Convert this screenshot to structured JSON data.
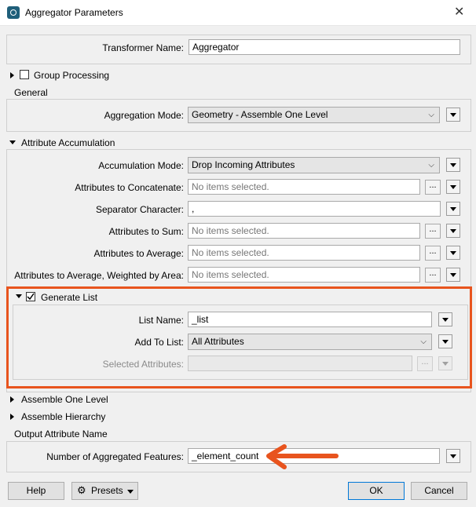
{
  "window": {
    "title": "Aggregator Parameters",
    "close": "✕"
  },
  "transformer": {
    "label": "Transformer Name:",
    "value": "Aggregator"
  },
  "group_processing": {
    "label": "Group Processing"
  },
  "general": {
    "title": "General",
    "aggregation_mode": {
      "label": "Aggregation Mode:",
      "value": "Geometry - Assemble One Level"
    }
  },
  "attribute_accumulation": {
    "title": "Attribute Accumulation",
    "accumulation_mode": {
      "label": "Accumulation Mode:",
      "value": "Drop Incoming Attributes"
    },
    "concatenate": {
      "label": "Attributes to Concatenate:",
      "placeholder": "No items selected."
    },
    "separator": {
      "label": "Separator Character:",
      "value": ","
    },
    "sum": {
      "label": "Attributes to Sum:",
      "placeholder": "No items selected."
    },
    "average": {
      "label": "Attributes to Average:",
      "placeholder": "No items selected."
    },
    "weighted": {
      "label": "Attributes to Average, Weighted by Area:",
      "placeholder": "No items selected."
    }
  },
  "generate_list": {
    "title": "Generate List",
    "checked": true,
    "list_name": {
      "label": "List Name:",
      "value": "_list"
    },
    "add_to_list": {
      "label": "Add To List:",
      "value": "All Attributes"
    },
    "selected_attributes": {
      "label": "Selected Attributes:",
      "value": ""
    }
  },
  "assemble_one_level": {
    "title": "Assemble One Level"
  },
  "assemble_hierarchy": {
    "title": "Assemble Hierarchy"
  },
  "output": {
    "title": "Output Attribute Name",
    "count": {
      "label": "Number of Aggregated Features:",
      "value": "_element_count"
    }
  },
  "buttons": {
    "help": "Help",
    "presets": "Presets",
    "ok": "OK",
    "cancel": "Cancel"
  },
  "ellipsis": "...",
  "colors": {
    "highlight": "#e8541e",
    "ok_border": "#0078d7"
  }
}
